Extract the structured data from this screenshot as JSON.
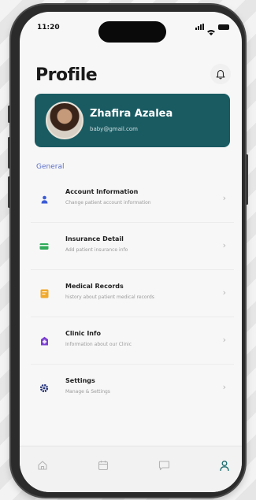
{
  "status_bar": {
    "time": "11:20"
  },
  "header": {
    "title": "Profile"
  },
  "profile": {
    "name": "Zhafira Azalea",
    "email": "baby@gmail.com"
  },
  "section_label": "General",
  "menu": [
    {
      "title": "Account Information",
      "subtitle": "Change patient account information",
      "icon": "person-icon",
      "color": "#3b5bd6"
    },
    {
      "title": "Insurance Detail",
      "subtitle": "Add patient insurance info",
      "icon": "card-icon",
      "color": "#2faa5a"
    },
    {
      "title": "Medical Records",
      "subtitle": "history about patient medical records",
      "icon": "document-icon",
      "color": "#f0a92b"
    },
    {
      "title": "Clinic Info",
      "subtitle": "Information about our Clinic",
      "icon": "clinic-icon",
      "color": "#7b3fd0"
    },
    {
      "title": "Settings",
      "subtitle": "Manage & Settings",
      "icon": "gear-icon",
      "color": "#24337a"
    }
  ],
  "tabbar": {
    "tabs": [
      "home-icon",
      "calendar-icon",
      "chat-icon",
      "profile-icon"
    ],
    "active": "profile-icon",
    "active_color": "#1a6b6e"
  },
  "colors": {
    "card_bg": "#1a5b62",
    "section_label": "#5a6ec9"
  }
}
